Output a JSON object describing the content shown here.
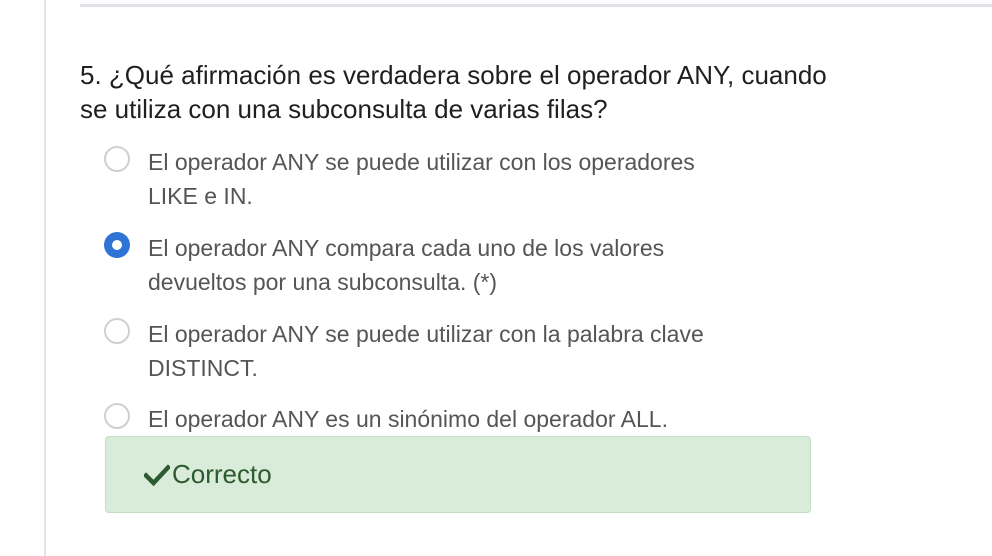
{
  "question": {
    "line1": "5. ¿Qué afirmación es verdadera sobre el operador ANY, cuando",
    "line2": "se utiliza con una subconsulta de varias filas?"
  },
  "options": [
    {
      "lines": [
        "El operador ANY se puede utilizar con los operadores",
        "LIKE e IN."
      ],
      "selected": false
    },
    {
      "lines": [
        "El operador ANY compara cada uno de los valores",
        "devueltos por una subconsulta. (*)"
      ],
      "selected": true
    },
    {
      "lines": [
        "El operador ANY se puede utilizar con la palabra clave",
        "DISTINCT."
      ],
      "selected": false
    },
    {
      "lines": [
        "El operador ANY es un sinónimo del operador ALL."
      ],
      "selected": false
    }
  ],
  "feedback": {
    "icon": "check-icon",
    "text": "Correcto"
  },
  "colors": {
    "radio_selected": "#2f73d5",
    "feedback_bg": "#d9ebd9",
    "feedback_text": "#2d5a2f"
  }
}
